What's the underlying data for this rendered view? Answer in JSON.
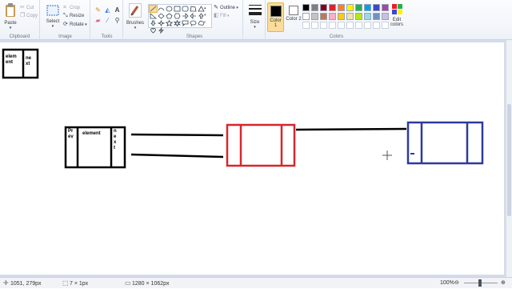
{
  "ribbon": {
    "clipboard": {
      "label": "Clipboard",
      "paste": "Paste",
      "cut": "Cut",
      "copy": "Copy"
    },
    "image": {
      "label": "Image",
      "select": "Select",
      "crop": "Crop",
      "resize": "Resize",
      "rotate": "Rotate"
    },
    "tools": {
      "label": "Tools",
      "icons": [
        "pencil-icon",
        "fill-icon",
        "text-icon",
        "eraser-icon",
        "color-picker-icon",
        "magnifier-icon"
      ]
    },
    "brushes": {
      "label": "Brushes"
    },
    "shapes": {
      "label": "Shapes",
      "outline": "Outline",
      "fill": "Fill"
    },
    "size": {
      "label": "Size"
    },
    "colors": {
      "label": "Colors",
      "color1": "Color 1",
      "color2": "Color 2",
      "edit": "Edit colors",
      "color1_value": "#000000",
      "color2_value": "#ffffff",
      "palette_row1": [
        "#000000",
        "#7f7f7f",
        "#880015",
        "#ed1c24",
        "#ff7f27",
        "#fff200",
        "#22b14c",
        "#00a2e8",
        "#3f48cc",
        "#a349a4"
      ],
      "palette_row2": [
        "#ffffff",
        "#c3c3c3",
        "#b97a57",
        "#ffaec9",
        "#ffc90e",
        "#efe4b0",
        "#b5e61d",
        "#99d9ea",
        "#7092be",
        "#c8bfe7"
      ]
    }
  },
  "drawing": {
    "small_box_left": "elem ent",
    "small_box_right": "ne xt",
    "node_prev": "Pr ev",
    "node_element": "element",
    "node_next": "n e x t",
    "red_color": "#d7262b",
    "blue_color": "#2d3a9e"
  },
  "status": {
    "cursor": "1051, 279px",
    "selection": "7 × 1px",
    "size": "1280 × 1062px",
    "zoom": "100%"
  }
}
